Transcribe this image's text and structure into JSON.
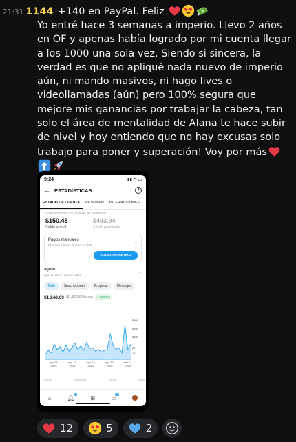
{
  "message": {
    "time": "21:31",
    "count": "1144",
    "first_line": "+140 en PayPal. Feliz",
    "body": "Yo entré hace 3 semanas a imperio. Llevo 2 años en OF y apenas había logrado por mi cuenta llegar a los 1000 una sola vez. Siendo si sincera, la verdad es que no apliqué nada nuevo de imperio aún, ni mando masivos, ni hago lives o videollamadas (aún) pero 100% segura que mejore mis ganancias por trabajar la cabeza, tan solo el área de mentalidad de Alana te hace subir de nivel y hoy entiendo que no hay excusas solo trabajo para poner y superación! Voy por más"
  },
  "phone": {
    "status_time": "9:24",
    "header_title": "ESTADÍSTICAS",
    "tabs": [
      "ESTADO DE CUENTA",
      "RESUMEN",
      "INTERACCIONES"
    ],
    "notice": "¡Estás en el Top 4% de todos los creadores!",
    "current_balance": "$150.45",
    "current_balance_label": "Saldo actual",
    "pending_balance": "$483.94",
    "pending_balance_label": "Saldo pendiente",
    "manual_payments_label": "Pagos manuales",
    "manual_payments_sub": "El monto mínimo de retiro es $20",
    "withdraw_button": "SOLICITAR RETIRO",
    "month_label": "agosto",
    "month_range": "ago 01, 2025 - ago 31, 2025",
    "chips": [
      "Todo",
      "Suscripciones",
      "Propinas",
      "Mensajes"
    ],
    "earnings": "$1,248.69",
    "earnings_gross": "($1,560.89 Bruto)",
    "earnings_change": "↗ 289.2%",
    "bottom_labels": [
      "Fecha",
      "Cantidad",
      "Tarifa",
      "Neto"
    ]
  },
  "chart_data": {
    "type": "area",
    "y_ticks": [
      "$300",
      "$200",
      "$100",
      "20",
      "10"
    ],
    "x_ticks": [
      "ago 04,\n2025",
      "ago 11,\n2025",
      "ago 18,\n2025",
      "ago 25,\n2025",
      "sep 01,\n2025"
    ],
    "series": [
      {
        "values": [
          30,
          55,
          40,
          90,
          60,
          75,
          45,
          85,
          50,
          70,
          95,
          60,
          80,
          55,
          100,
          65,
          70,
          50,
          60,
          45,
          55,
          60,
          150,
          80,
          60,
          70,
          40,
          200,
          60,
          90
        ]
      },
      {
        "values": [
          10,
          12,
          15,
          11,
          16,
          13,
          18,
          14,
          12,
          17,
          15,
          13,
          16,
          19,
          14,
          12,
          13,
          15,
          11,
          14,
          12,
          16,
          18,
          13,
          15,
          12,
          14,
          20,
          12,
          15
        ]
      }
    ],
    "colors": [
      "#1b9bf0",
      "#8fcff7"
    ]
  },
  "reactions": [
    {
      "emoji": "heart",
      "count": "12"
    },
    {
      "emoji": "smiling-face-hearts",
      "count": "5"
    },
    {
      "emoji": "blue-heart",
      "count": "2"
    }
  ]
}
